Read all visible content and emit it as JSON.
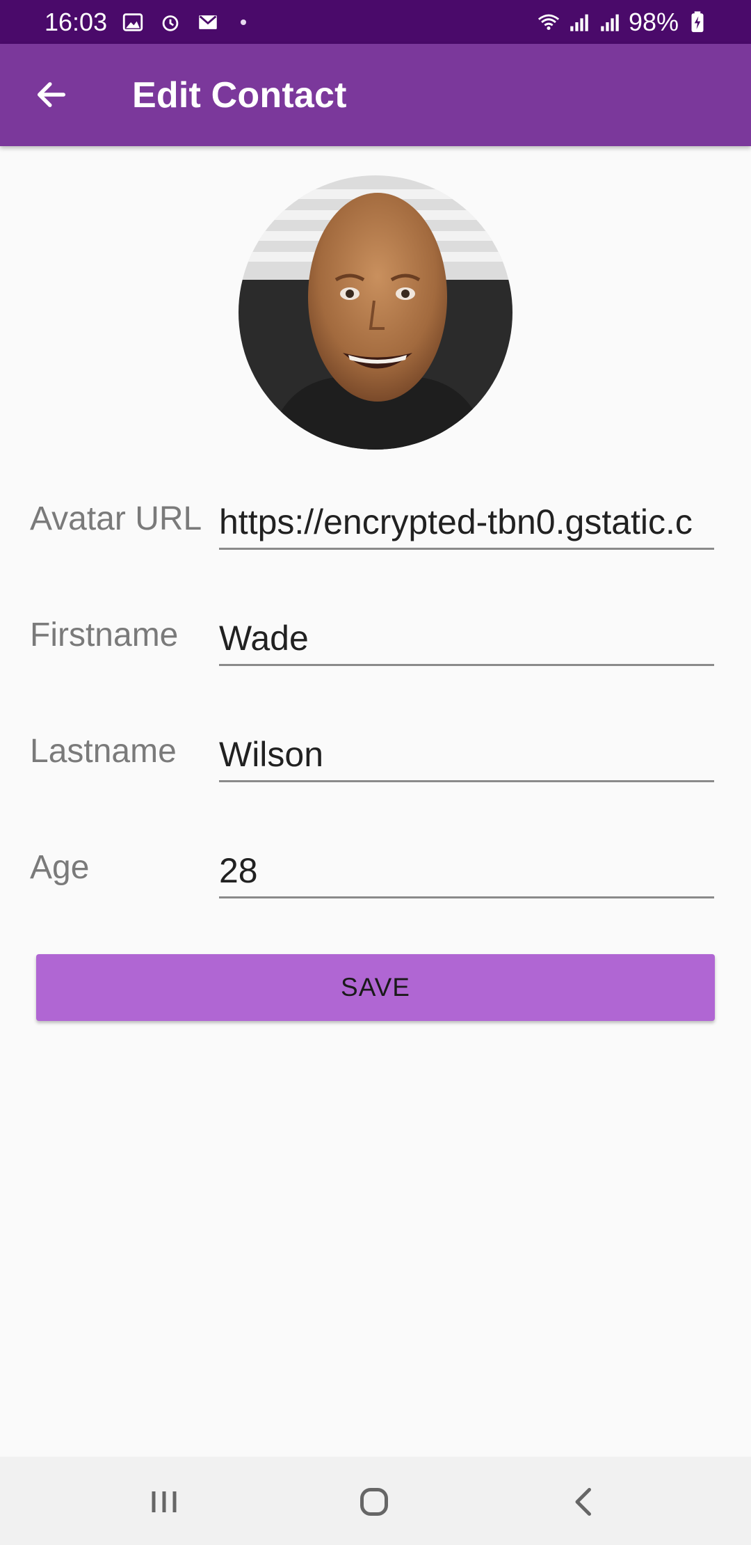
{
  "status_bar": {
    "time": "16:03",
    "battery": "98%",
    "left_icons": [
      "gallery-icon",
      "alarm-icon",
      "gmail-icon"
    ],
    "right_icons": [
      "wifi-icon",
      "signal-icon",
      "signal-icon",
      "battery-charging-icon"
    ]
  },
  "app_bar": {
    "title": "Edit Contact",
    "back_icon": "arrow-left-icon"
  },
  "form": {
    "avatar_url": {
      "label": "Avatar URL",
      "value": "https://encrypted-tbn0.gstatic.c"
    },
    "firstname": {
      "label": "Firstname",
      "value": "Wade"
    },
    "lastname": {
      "label": "Lastname",
      "value": "Wilson"
    },
    "age": {
      "label": "Age",
      "value": "28"
    }
  },
  "save_button": {
    "label": "SAVE"
  },
  "nav_bar": {
    "icons": [
      "recents-icon",
      "home-icon",
      "back-icon"
    ]
  },
  "colors": {
    "status_bar": "#4a0a6a",
    "app_bar": "#7b389b",
    "save_button": "#b066d3",
    "background": "#fafafa"
  }
}
